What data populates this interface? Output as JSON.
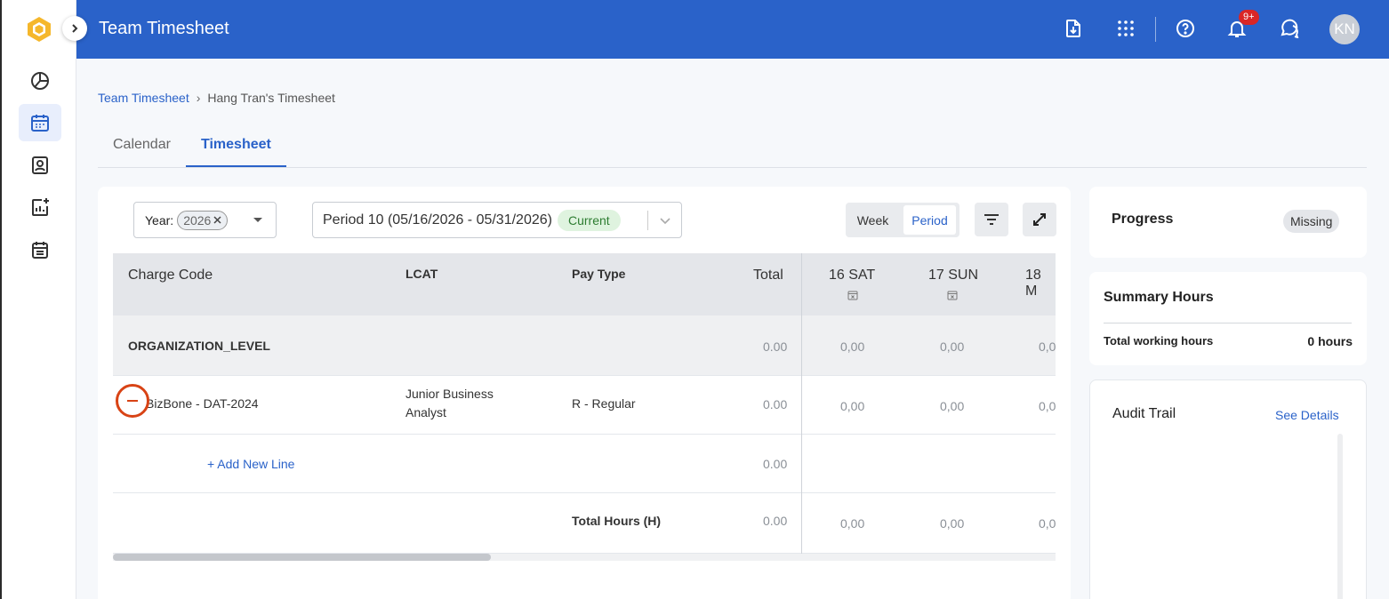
{
  "topbar": {
    "title": "Team Timesheet",
    "notification_count": "9+",
    "avatar_initials": "KN",
    "icons": [
      "export-file-icon",
      "apps-grid-icon",
      "help-icon",
      "bell-icon",
      "chat-icon"
    ]
  },
  "sidebar": {
    "icons": [
      "dashboard-pie-icon",
      "calendar-icon",
      "contact-card-icon",
      "report-add-icon",
      "schedule-list-icon"
    ],
    "active": "calendar-icon"
  },
  "breadcrumb": {
    "link": "Team Timesheet",
    "separator": "›",
    "current": "Hang Tran's Timesheet"
  },
  "tabs": [
    {
      "label": "Calendar",
      "active": false
    },
    {
      "label": "Timesheet",
      "active": true
    }
  ],
  "filters": {
    "year_label": "Year:",
    "year_value": "2026",
    "period_value": "Period 10 (05/16/2026 - 05/31/2026)",
    "period_badge": "Current",
    "view_week": "Week",
    "view_period": "Period",
    "active_view": "Period"
  },
  "table": {
    "headers": {
      "charge_code": "Charge Code",
      "lcat": "LCAT",
      "pay_type": "Pay Type",
      "total": "Total",
      "days": [
        "16 SAT",
        "17 SUN",
        "18 M"
      ]
    },
    "org_row": {
      "label": "ORGANIZATION_LEVEL",
      "total": "0.00",
      "days": [
        "0,00",
        "0,00",
        "0,0"
      ]
    },
    "data_row": {
      "charge_code": "BizBone - DAT-2024",
      "lcat_line1": "Junior Business",
      "lcat_line2": "Analyst",
      "pay_type": "R - Regular",
      "total": "0.00",
      "days": [
        "0,00",
        "0,00",
        "0,0"
      ]
    },
    "add_row": {
      "label": "+ Add New Line",
      "total": "0.00"
    },
    "total_row": {
      "label": "Total Hours (H)",
      "total": "0.00",
      "days": [
        "0,00",
        "0,00",
        "0,0"
      ]
    }
  },
  "progress": {
    "title": "Progress",
    "status": "Missing"
  },
  "summary": {
    "title": "Summary Hours",
    "label": "Total working hours",
    "value": "0 hours"
  },
  "audit": {
    "title": "Audit Trail",
    "link": "See Details"
  },
  "colors": {
    "brand": "#2a62c9",
    "success": "#2e7d32",
    "danger": "#d84315",
    "badge": "#d92626"
  }
}
